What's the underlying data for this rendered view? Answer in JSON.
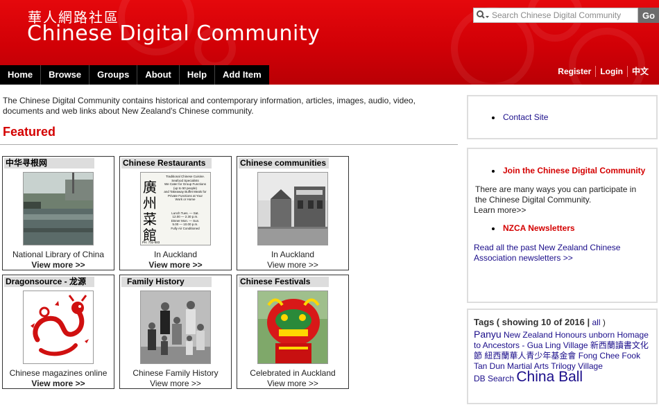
{
  "header": {
    "brand_cn": "華人網路社區",
    "brand_en": "Chinese Digital Community",
    "search_placeholder": "Search Chinese Digital Community",
    "search_button": "Go",
    "nav": [
      "Home",
      "Browse",
      "Groups",
      "About",
      "Help",
      "Add Item"
    ],
    "user_links": [
      "Register",
      "Login",
      "中文"
    ]
  },
  "main": {
    "intro": "The Chinese Digital Community contains historical and contemporary information, articles, images, audio, video, documents and web links about New Zealand's Chinese community.",
    "featured_title": "Featured",
    "cards": [
      {
        "title": "中华寻根网",
        "caption": "National Library of China",
        "more": "View more >>",
        "image": "river-photo"
      },
      {
        "title": "Chinese Restaurants",
        "caption": "In Auckland",
        "more": "View more >>",
        "image": "restaurant-ad"
      },
      {
        "title": "Chinese communities",
        "caption": "In Auckland",
        "more": "View more >>",
        "image": "street-photo"
      },
      {
        "title": "Dragonsource - 龙源",
        "caption": "Chinese magazines online",
        "more": "View more >>",
        "image": "dragon-logo"
      },
      {
        "title": "Family History",
        "caption": "Chinese Family History",
        "more": "View more >>",
        "image": "family-photo"
      },
      {
        "title": "Chinese Festivals",
        "caption": "Celebrated in Auckland",
        "more": "View more >>",
        "image": "lion-dance-photo"
      }
    ],
    "restaurant_ad": {
      "lines_top": [
        "Traditional Chinese Cuisine.",
        "Seafood Specialists",
        "We Cater for Group Functions",
        "(up to 50 people)",
        "and Takeaway Buffet Meals for",
        "Private Functions at Your",
        "Work or Home"
      ],
      "chars": [
        "廣",
        "州",
        "菜",
        "館"
      ],
      "lines_bottom": [
        "Lunch Tues. — Sat.",
        "12.00 — 2.30 p.m.",
        "Dinner Mon. — Sun.",
        "5.00 — 10.00 p.m.",
        "Fully Air Conditioned"
      ],
      "phone": "PH. 732-683"
    }
  },
  "sidebar": {
    "contact": "Contact Site",
    "join": "Join the Chinese Digital Community",
    "participate": "There are many ways you can participate in the Chinese Digital Community.",
    "learn_more": "Learn more>>",
    "newsletters": "NZCA Newsletters",
    "newsletters_desc": "Read all the past New Zealand Chinese Association newsletters >>",
    "tags_title": "Tags",
    "tags_sub": "( showing 10 of 2016 |",
    "tags_all": "all",
    "tags_close": ")",
    "tags": [
      "Panyu",
      "New Zealand Honours",
      "unborn",
      "Homage to Ancestors - Gua Ling",
      "Village",
      "新西蘭讀書文化節",
      "紐西蘭華人青少年基金會",
      "Fong Chee Fook",
      "Tan Dun",
      "Martial Arts",
      "Trilogy Village",
      "DB Search",
      "China Ball"
    ]
  },
  "colors": {
    "brand_red": "#d10006",
    "link_blue": "#1a0d8a",
    "nav_black": "#000000",
    "featured_red": "#d40000"
  }
}
